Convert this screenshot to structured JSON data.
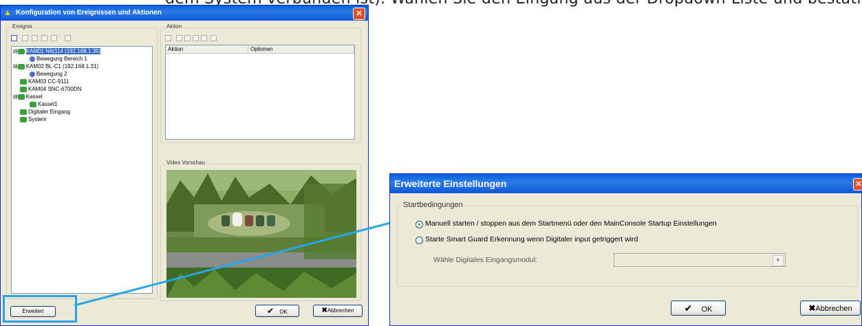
{
  "instruction_text": "dem System verbunden ist). Wählen Sie den Eingang aus der Dropdown-Liste und bestätigen",
  "left_window": {
    "title": "Konfiguration von Ereignissen und Aktionen",
    "ereignis_label": "Ereignis",
    "aktion_label": "Aktion",
    "video_label": "Video Vorschau",
    "tree": [
      "KAM01 N6(114 (192.168.1.35)",
      "Bewegung Bereich 1",
      "KAM02 BL-C1 (192.168.1.31)",
      "Bewegung 2",
      "KAM03 CC-9111",
      "KAM04 SNC-6700DN",
      "Kassel",
      "Kassel1",
      "Digitaler Eingang",
      "System"
    ],
    "table_headers": [
      "Aktion",
      "Optionen"
    ],
    "erweitert_button": "Erweitert",
    "ok_button": "OK",
    "cancel_button": "Abbrechen"
  },
  "right_window": {
    "title": "Erweiterte Einstellungen",
    "group_label": "Startbedingungen",
    "option1": "Manuell starten / stoppen aus dem Startmenü oder den MainConsole Startup Einstellungen",
    "option2": "Starte Smart Guard Erkennung wenn Digitaler input getriggert wird",
    "input_module_label": "Wähle Digitales Eingangsmodul:",
    "input_module_value": "",
    "ok_button": "OK",
    "cancel_button": "Abbrechen",
    "option1_selected": true
  },
  "colors": {
    "callout": "#2aa4e8",
    "titlebar": "#0a5fd8",
    "selection": "#316ac5"
  }
}
